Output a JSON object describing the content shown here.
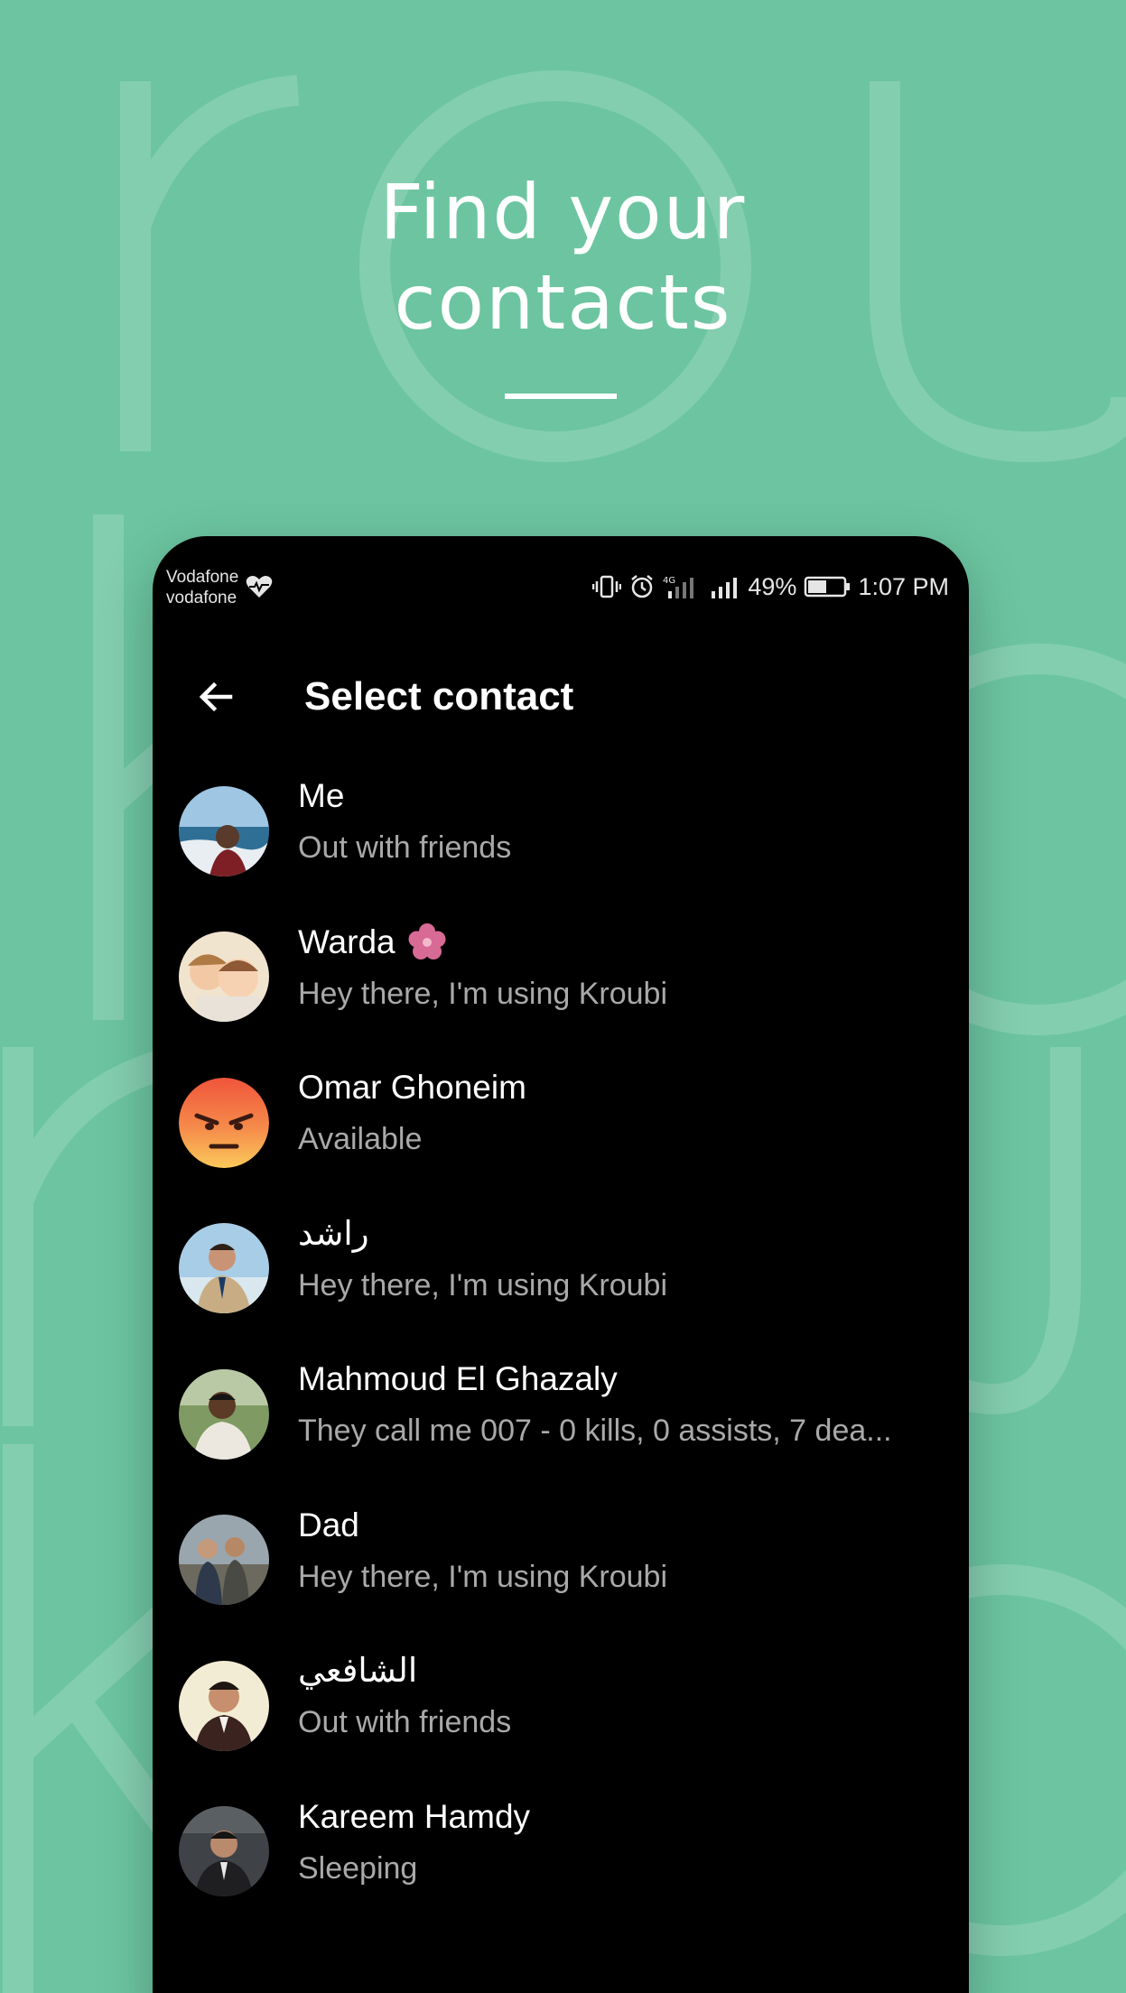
{
  "headline": {
    "line1": "Find your",
    "line2": "contacts"
  },
  "background_letters": [
    "r",
    "o",
    "u",
    "k",
    "r",
    "o",
    "u",
    "k",
    "r",
    "u",
    "o"
  ],
  "status_bar": {
    "carrier_line1": "Vodafone",
    "carrier_line2": "vodafone",
    "battery": "49%",
    "time": "1:07 PM"
  },
  "app_bar": {
    "title": "Select contact",
    "back_icon": "arrow-left-icon"
  },
  "contacts": [
    {
      "name": "Me",
      "status": "Out with friends",
      "avatar": "photo-sea"
    },
    {
      "name": "Warda",
      "status": "Hey there, I'm using Kroubi",
      "avatar": "photo-children",
      "badge_icon": "flower-icon"
    },
    {
      "name": "Omar Ghoneim",
      "status": "Available",
      "avatar": "angry-face-emoji"
    },
    {
      "name": "راشد",
      "status": "Hey there, I'm using Kroubi",
      "avatar": "photo-suit"
    },
    {
      "name": "Mahmoud El Ghazaly",
      "status": "They call me 007 - 0 kills, 0 assists, 7 dea...",
      "avatar": "photo-outdoor"
    },
    {
      "name": "Dad",
      "status": "Hey there, I'm using Kroubi",
      "avatar": "photo-group"
    },
    {
      "name": "الشافعي",
      "status": "Out with friends",
      "avatar": "photo-portrait"
    },
    {
      "name": "Kareem Hamdy",
      "status": "Sleeping",
      "avatar": "photo-dark"
    }
  ],
  "colors": {
    "background": "#6cc5a0",
    "phone": "#000000",
    "primary_text": "#ffffff",
    "secondary_text": "#a9a9a9"
  }
}
